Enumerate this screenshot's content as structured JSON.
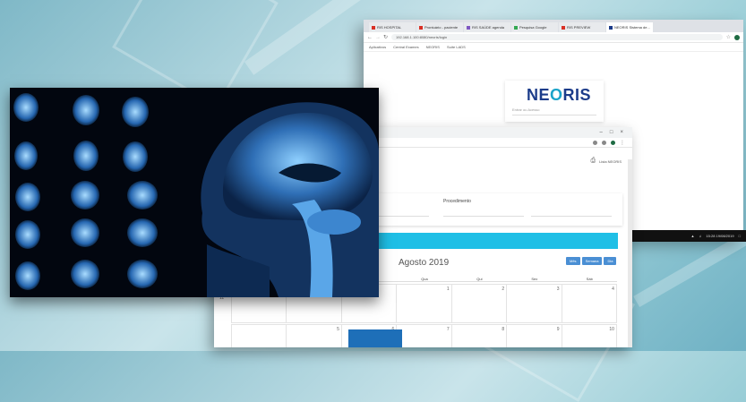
{
  "back_window": {
    "tabs": [
      "RIS HOSPITAL",
      "Prontuário - paciente",
      "RIS SAÚDE agenda",
      "Pesquisa Google",
      "RIS PREVIEW",
      "NEORIS Sistema de..."
    ],
    "address": "192.168.1.100:8080/neoris/login",
    "bookmarks": [
      "Aplicativos",
      "Central Exames",
      "NEORIS",
      "Suíte LADS"
    ],
    "logo_prefix": "NE",
    "logo_letter": "O",
    "logo_suffix": "RIS",
    "login_placeholder": "Entrar ou Acesso",
    "taskbar_time": "15:28",
    "taskbar_date": "19/08/2019"
  },
  "front_window": {
    "header_user": "Lista NEORIS",
    "filter_label": "Procedimento",
    "calendar_title": "Agosto 2019",
    "view_buttons": [
      "Mês",
      "Semana",
      "Dia"
    ],
    "weekdays": [
      "Dom",
      "Seg",
      "Ter",
      "Qua",
      "Qui",
      "Sex",
      "Sáb"
    ],
    "week1": [
      "",
      "",
      "",
      "1",
      "2",
      "3",
      "4"
    ],
    "week2": [
      "",
      "5",
      "6",
      "7",
      "8",
      "9",
      "10"
    ],
    "side_number": "11"
  },
  "colors": {
    "accent": "#1fbfe6",
    "event": "#1e6fb8",
    "logo_dark": "#1c3c8a",
    "logo_light": "#1aa3c9"
  }
}
